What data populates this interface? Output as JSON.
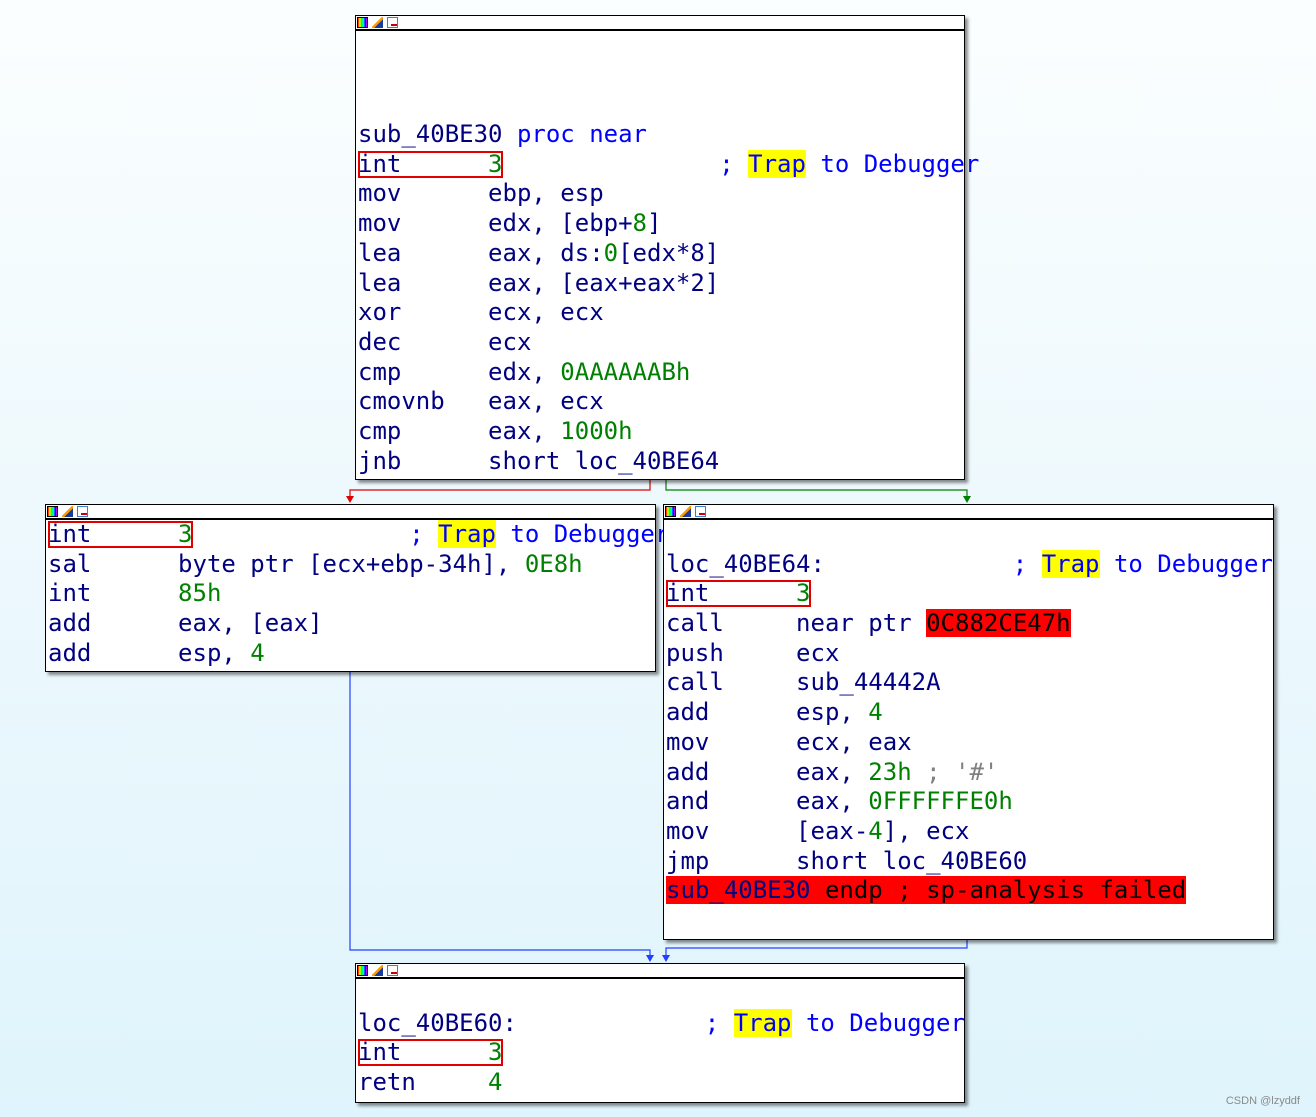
{
  "colors": {
    "true_edge": "#008000",
    "false_edge": "#e00000",
    "jump_edge": "#2040ff",
    "highlight": "#ffff00",
    "error": "#ff0000"
  },
  "blocks": [
    {
      "id": "sub_40BE30",
      "blank_lines": 3,
      "lines": [
        {
          "rest": [
            {
              "t": "sub_40BE30 ",
              "c": "k"
            },
            {
              "t": "proc near",
              "c": "c"
            }
          ]
        },
        {
          "box": [
            {
              "t": "int      ",
              "c": "k"
            },
            {
              "t": "3",
              "c": "n"
            }
          ],
          "rest": [
            {
              "t": "               ; ",
              "c": "c"
            },
            {
              "t": "Trap",
              "c": "hl"
            },
            {
              "t": " to Debugger",
              "c": "c"
            }
          ]
        },
        {
          "rest": [
            {
              "t": "mov      ebp, esp",
              "c": "k"
            }
          ]
        },
        {
          "rest": [
            {
              "t": "mov      edx, [ebp+",
              "c": "k"
            },
            {
              "t": "8",
              "c": "n"
            },
            {
              "t": "]",
              "c": "k"
            }
          ]
        },
        {
          "rest": [
            {
              "t": "lea      eax, ds:",
              "c": "k"
            },
            {
              "t": "0",
              "c": "n"
            },
            {
              "t": "[edx*8]",
              "c": "k"
            }
          ]
        },
        {
          "rest": [
            {
              "t": "lea      eax, [eax+eax*2]",
              "c": "k"
            }
          ]
        },
        {
          "rest": [
            {
              "t": "xor      ecx, ecx",
              "c": "k"
            }
          ]
        },
        {
          "rest": [
            {
              "t": "dec      ecx",
              "c": "k"
            }
          ]
        },
        {
          "rest": [
            {
              "t": "cmp      edx, ",
              "c": "k"
            },
            {
              "t": "0AAAAAABh",
              "c": "n"
            }
          ]
        },
        {
          "rest": [
            {
              "t": "cmovnb   eax, ecx",
              "c": "k"
            }
          ]
        },
        {
          "rest": [
            {
              "t": "cmp      eax, ",
              "c": "k"
            },
            {
              "t": "1000h",
              "c": "n"
            }
          ]
        },
        {
          "rest": [
            {
              "t": "jnb      short loc_40BE64",
              "c": "k"
            }
          ]
        }
      ]
    },
    {
      "id": "false_branch",
      "blank_lines": 0,
      "lines": [
        {
          "box": [
            {
              "t": "int      ",
              "c": "k"
            },
            {
              "t": "3",
              "c": "n"
            }
          ],
          "rest": [
            {
              "t": "               ; ",
              "c": "c"
            },
            {
              "t": "Trap",
              "c": "hl"
            },
            {
              "t": " to Debugger",
              "c": "c"
            }
          ]
        },
        {
          "rest": [
            {
              "t": "sal      byte ptr [ecx+ebp-34h], ",
              "c": "k"
            },
            {
              "t": "0E8h",
              "c": "n"
            }
          ]
        },
        {
          "rest": [
            {
              "t": "int      ",
              "c": "k"
            },
            {
              "t": "85h",
              "c": "n"
            }
          ]
        },
        {
          "rest": [
            {
              "t": "add      eax, [eax]",
              "c": "k"
            }
          ]
        },
        {
          "rest": [
            {
              "t": "add      esp, ",
              "c": "k"
            },
            {
              "t": "4",
              "c": "n"
            }
          ]
        }
      ]
    },
    {
      "id": "loc_40BE64",
      "blank_lines": 1,
      "lines": [
        {
          "rest": [
            {
              "t": "loc_40BE64:",
              "c": "k"
            },
            {
              "t": "             ; ",
              "c": "c"
            },
            {
              "t": "Trap",
              "c": "hl"
            },
            {
              "t": " to Debugger",
              "c": "c"
            }
          ]
        },
        {
          "box": [
            {
              "t": "int      ",
              "c": "k"
            },
            {
              "t": "3",
              "c": "n"
            }
          ]
        },
        {
          "rest": [
            {
              "t": "call     near ptr ",
              "c": "k"
            },
            {
              "t": "0C882CE47h",
              "c": "red"
            }
          ]
        },
        {
          "rest": [
            {
              "t": "push     ecx",
              "c": "k"
            }
          ]
        },
        {
          "rest": [
            {
              "t": "call     sub_44442A",
              "c": "k"
            }
          ]
        },
        {
          "rest": [
            {
              "t": "add      esp, ",
              "c": "k"
            },
            {
              "t": "4",
              "c": "n"
            }
          ]
        },
        {
          "rest": [
            {
              "t": "mov      ecx, eax",
              "c": "k"
            }
          ]
        },
        {
          "rest": [
            {
              "t": "add      eax, ",
              "c": "k"
            },
            {
              "t": "23h",
              "c": "n"
            },
            {
              "t": " ; '#'",
              "c": "g"
            }
          ]
        },
        {
          "rest": [
            {
              "t": "and      eax, ",
              "c": "k"
            },
            {
              "t": "0FFFFFFE0h",
              "c": "n"
            }
          ]
        },
        {
          "rest": [
            {
              "t": "mov      [eax-",
              "c": "k"
            },
            {
              "t": "4",
              "c": "n"
            },
            {
              "t": "], ecx",
              "c": "k"
            }
          ]
        },
        {
          "rest": [
            {
              "t": "jmp      short loc_40BE60",
              "c": "k"
            }
          ]
        },
        {
          "rest": [
            {
              "t": "sub_40BE30",
              "c": "redn"
            },
            {
              "t": " endp ; sp-analysis failed",
              "c": "redk"
            }
          ]
        }
      ]
    },
    {
      "id": "loc_40BE60",
      "blank_lines": 1,
      "lines": [
        {
          "rest": [
            {
              "t": "loc_40BE60:",
              "c": "k"
            },
            {
              "t": "             ; ",
              "c": "c"
            },
            {
              "t": "Trap",
              "c": "hl"
            },
            {
              "t": " to Debugger",
              "c": "c"
            }
          ]
        },
        {
          "box": [
            {
              "t": "int      ",
              "c": "k"
            },
            {
              "t": "3",
              "c": "n"
            }
          ]
        },
        {
          "rest": [
            {
              "t": "retn     ",
              "c": "k"
            },
            {
              "t": "4",
              "c": "n"
            }
          ]
        }
      ]
    }
  ],
  "header_icons": [
    "color-icon",
    "edit-icon",
    "graph-icon"
  ],
  "watermark": "CSDN @lzyddf"
}
